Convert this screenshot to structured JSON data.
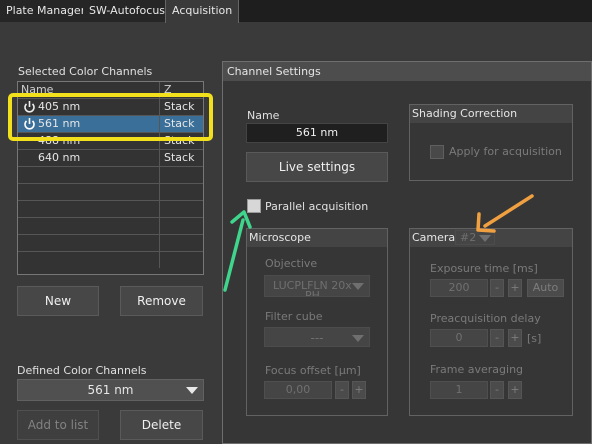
{
  "tabs": [
    "Plate Manager",
    "SW-Autofocus",
    "Acquisition"
  ],
  "selected_channels": {
    "title": "Selected Color Channels",
    "columns": [
      "Name",
      "Z"
    ],
    "rows": [
      {
        "name": "405 nm",
        "z": "Stack",
        "icon": "power-icon"
      },
      {
        "name": "561 nm",
        "z": "Stack",
        "icon": "power-icon",
        "selected": true
      },
      {
        "name": "488 nm",
        "z": "Stack"
      },
      {
        "name": "640 nm",
        "z": "Stack"
      }
    ]
  },
  "buttons": {
    "new": "New",
    "remove": "Remove",
    "add_to_list": "Add to list",
    "delete": "Delete",
    "live_settings": "Live settings"
  },
  "defined_channels": {
    "label": "Defined Color Channels",
    "value": "561 nm"
  },
  "channel_settings": {
    "title": "Channel Settings",
    "name_label": "Name",
    "name_value": "561 nm",
    "parallel_acquisition": "Parallel acquisition",
    "shading_correction": {
      "title": "Shading Correction",
      "apply_label": "Apply for acquisition"
    },
    "microscope": {
      "title": "Microscope",
      "objective_label": "Objective",
      "objective_value": "LUCPLFLN 20x",
      "objective_value_cut": "PH",
      "filter_cube_label": "Filter cube",
      "filter_cube_value": "---",
      "focus_offset_label": "Focus offset [µm]",
      "focus_offset_value": "0,00",
      "minus": "-",
      "plus": "+"
    },
    "camera": {
      "title": "Camera",
      "selection": "#2",
      "exposure_label": "Exposure time [ms]",
      "exposure_value": "200",
      "auto": "Auto",
      "preacq_label": "Preacquisition delay",
      "preacq_value": "0",
      "preacq_unit": "[s]",
      "frame_avg_label": "Frame averaging",
      "frame_avg_value": "1",
      "minus": "-",
      "plus": "+"
    }
  },
  "colors": {
    "highlight_box": "#f2e01c",
    "green_arrow": "#3fd58c",
    "orange_arrow": "#f0a040",
    "selection": "#3a6f99"
  }
}
